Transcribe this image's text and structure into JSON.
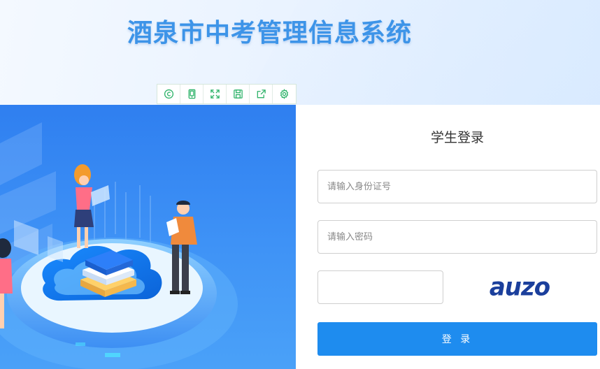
{
  "header": {
    "title": "酒泉市中考管理信息系统"
  },
  "toolbar": {
    "icons": [
      "copyright-icon",
      "tablet-icon",
      "expand-icon",
      "save-icon",
      "share-icon",
      "settings-icon"
    ],
    "color": "#2fb36a"
  },
  "login": {
    "title": "学生登录",
    "id_placeholder": "请输入身份证号",
    "id_value": "",
    "password_placeholder": "请输入密码",
    "password_value": "",
    "captcha_value": "",
    "captcha_image_text": "auzo",
    "submit_label": "登 录"
  },
  "colors": {
    "title": "#3d94e8",
    "button": "#1e8cef",
    "illustration_bg": "#2f7ff0"
  }
}
